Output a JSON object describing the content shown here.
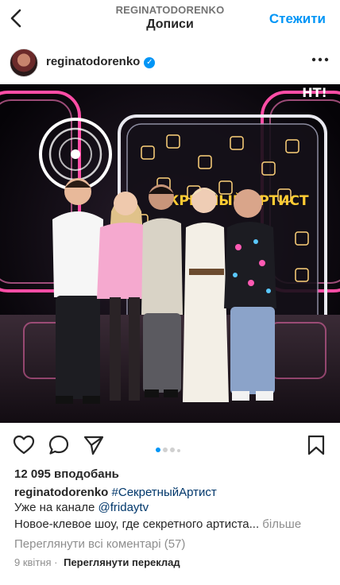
{
  "header": {
    "account_label": "REGINATODORENKO",
    "title": "Дописи",
    "follow_label": "Стежити"
  },
  "post": {
    "username": "reginatodorenko",
    "image_logo": "НТ!",
    "image_sign": "СЕКРЕТНЫЙ АРТИСТ",
    "likes": "12 095 вподобань",
    "caption_user": "reginatodorenko",
    "caption_tag": "#СекретныйАртист",
    "caption_line2_text": "Уже на канале ",
    "caption_line2_link": "@fridaytv",
    "caption_line3": "Новое-клевое шоу, где секретного артиста...",
    "more_label": " більше",
    "comments_label": "Переглянути всі коментарі (57)",
    "date": "9 квітня",
    "separator": "·",
    "translate_label": "Переглянути переклад",
    "carousel": {
      "count": 4,
      "active": 1
    }
  },
  "icons": {
    "back": "chevron-left-icon",
    "verified": "verified-badge-icon",
    "more": "more-horizontal-icon",
    "like": "heart-icon",
    "comment": "comment-icon",
    "share": "send-icon",
    "save": "bookmark-icon"
  },
  "colors": {
    "accent": "#0095f6",
    "text": "#262626",
    "muted": "#8e8e8e",
    "link": "#00376b"
  }
}
